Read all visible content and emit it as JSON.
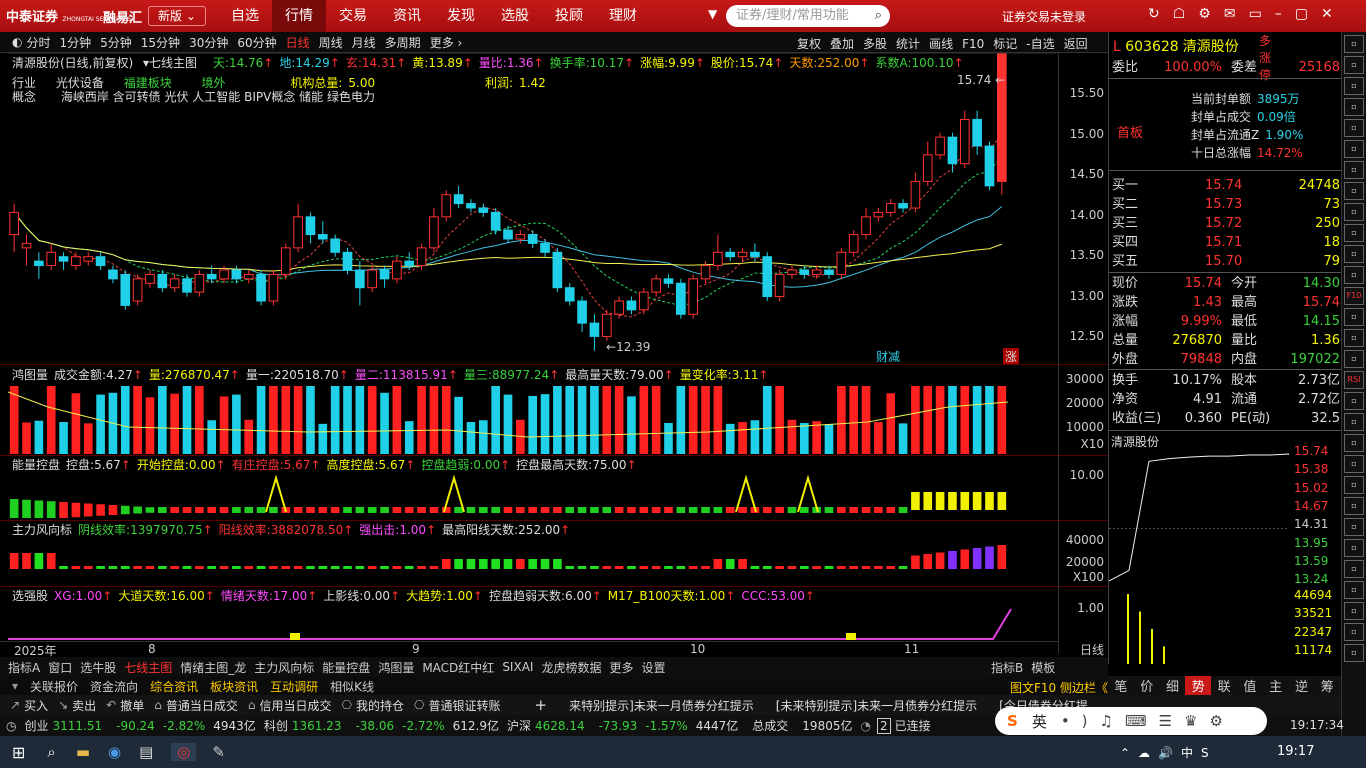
{
  "app": {
    "logo": "中泰证券",
    "logo_sub": "ZHONGTAI SECURITIES",
    "brand": "融易汇",
    "version": "新版",
    "menu": [
      "自选",
      "行情",
      "交易",
      "资讯",
      "发现",
      "选股",
      "投顾",
      "理财"
    ],
    "search_placeholder": "证券/理财/常用功能",
    "login": "证券交易未登录"
  },
  "toolbar": {
    "periods": [
      "分时",
      "1分钟",
      "5分钟",
      "15分钟",
      "30分钟",
      "60分钟",
      "日线",
      "周线",
      "月线",
      "多周期",
      "更多 ›"
    ],
    "tools": [
      "复权",
      "叠加",
      "多股",
      "统计",
      "画线",
      "F10",
      "标记",
      "-自选",
      "返回"
    ]
  },
  "ind1": {
    "name": "清源股份(日线,前复权)",
    "main": "七线主图",
    "items": [
      {
        "l": "天:",
        "v": "14.76",
        "c": "grn"
      },
      {
        "l": "地:",
        "v": "14.29",
        "c": "cyn"
      },
      {
        "l": "玄:",
        "v": "14.31",
        "c": "red"
      },
      {
        "l": "黄:",
        "v": "13.89",
        "c": "yel"
      },
      {
        "l": "量比:",
        "v": "1.36",
        "c": "mag"
      },
      {
        "l": "换手率:",
        "v": "10.17",
        "c": "grn"
      },
      {
        "l": "涨幅:",
        "v": "9.99",
        "c": "yel"
      },
      {
        "l": "股价:",
        "v": "15.74",
        "c": "yel"
      },
      {
        "l": "天数:",
        "v": "252.00",
        "c": "org"
      },
      {
        "l": "系数A:",
        "v": "100.10",
        "c": "grn"
      }
    ]
  },
  "info": {
    "industry_label": "行业",
    "industry": "光伏设备",
    "region": "福建板块",
    "abroad": "境外",
    "inst_label": "机构总量:",
    "inst": "5.00",
    "profit_label": "利润:",
    "profit": "1.42",
    "concept_label": "概念",
    "concepts": "海峡西岸 含可转债 光伏 人工智能 BIPV概念 储能 绿色电力"
  },
  "chart_labels": {
    "high": "15.74",
    "low": "12.39",
    "tag1": "财减",
    "tag2": "涨"
  },
  "ind2": {
    "name": "鸿图量",
    "items": [
      {
        "l": "成交金额:",
        "v": "4.27",
        "c": "wht"
      },
      {
        "l": "量:",
        "v": "276870.47",
        "c": "yel"
      },
      {
        "l": "量一:",
        "v": "220518.70",
        "c": "wht"
      },
      {
        "l": "量二:",
        "v": "113815.91",
        "c": "mag"
      },
      {
        "l": "量三:",
        "v": "88977.24",
        "c": "grn"
      },
      {
        "l": "最高量天数:",
        "v": "79.00",
        "c": "wht"
      },
      {
        "l": "量变化率:",
        "v": "3.11",
        "c": "yel"
      }
    ]
  },
  "ind3": {
    "name": "能量控盘",
    "items": [
      {
        "l": "控盘:",
        "v": "5.67",
        "c": "wht"
      },
      {
        "l": "开始控盘:",
        "v": "0.00",
        "c": "yel"
      },
      {
        "l": "有庄控盘:",
        "v": "5.67",
        "c": "red"
      },
      {
        "l": "高度控盘:",
        "v": "5.67",
        "c": "yel"
      },
      {
        "l": "控盘趋弱:",
        "v": "0.00",
        "c": "grn"
      },
      {
        "l": "控盘最高天数:",
        "v": "75.00",
        "c": "wht"
      }
    ]
  },
  "ind4": {
    "name": "主力风向标",
    "items": [
      {
        "l": "阴线效率:",
        "v": "1397970.75",
        "c": "grn"
      },
      {
        "l": "阳线效率:",
        "v": "3882078.50",
        "c": "red"
      },
      {
        "l": "强出击:",
        "v": "1.00",
        "c": "mag"
      },
      {
        "l": "最高阳线天数:",
        "v": "252.00",
        "c": "wht"
      }
    ]
  },
  "ind5": {
    "name": "选强股",
    "items": [
      {
        "l": "XG:",
        "v": "1.00",
        "c": "mag"
      },
      {
        "l": "大道天数:",
        "v": "16.00",
        "c": "yel"
      },
      {
        "l": "情绪天数:",
        "v": "17.00",
        "c": "mag"
      },
      {
        "l": "上影线:",
        "v": "0.00",
        "c": "wht"
      },
      {
        "l": "大趋势:",
        "v": "1.00",
        "c": "yel"
      },
      {
        "l": "控盘趋弱天数:",
        "v": "6.00",
        "c": "wht"
      },
      {
        "l": "M17_B100天数:",
        "v": "1.00",
        "c": "yel"
      },
      {
        "l": "CCC:",
        "v": "53.00",
        "c": "mag"
      }
    ]
  },
  "axes": {
    "price": [
      "15.50",
      "15.00",
      "14.50",
      "14.00",
      "13.50",
      "13.00",
      "12.50"
    ],
    "vol": [
      "30000",
      "20000",
      "10000"
    ],
    "vol_mult": "X10",
    "energy": [
      "10.00"
    ],
    "flow": [
      "40000",
      "20000"
    ],
    "flow_mult": "X100",
    "pick": [
      "1.00"
    ],
    "months": [
      "2025年",
      "8",
      "9",
      "10",
      "11"
    ],
    "period": "日线"
  },
  "tabs1": [
    "指标A",
    "窗口",
    "选牛股",
    "七线主图",
    "情绪主图_龙",
    "主力风向标",
    "能量控盘",
    "鸿图量",
    "MACD红中红",
    "SIXAI",
    "龙虎榜数据",
    "更多",
    "设置"
  ],
  "tabs1_right": [
    "指标B",
    "模板"
  ],
  "tabs2": [
    "关联报价",
    "资金流向",
    "综合资讯",
    "板块资讯",
    "互动调研",
    "相似K线"
  ],
  "right": {
    "code": "603628",
    "name": "清源股份",
    "tag": "多涨停",
    "wb_l": "委比",
    "wb": "100.00%",
    "wc_l": "委差",
    "wc": "25168",
    "board": "首板",
    "seal": [
      {
        "l": "当前封单额",
        "v": "3895万"
      },
      {
        "l": "封单占成交",
        "v": "0.09倍"
      },
      {
        "l": "封单占流通Z",
        "v": "1.90%"
      },
      {
        "l": "十日总涨幅",
        "v": "14.72%"
      }
    ],
    "bids": [
      {
        "l": "买一",
        "p": "15.74",
        "q": "24748"
      },
      {
        "l": "买二",
        "p": "15.73",
        "q": "73"
      },
      {
        "l": "买三",
        "p": "15.72",
        "q": "250"
      },
      {
        "l": "买四",
        "p": "15.71",
        "q": "18"
      },
      {
        "l": "买五",
        "p": "15.70",
        "q": "79"
      }
    ],
    "quote": [
      {
        "l": "现价",
        "v": "15.74",
        "l2": "今开",
        "v2": "14.30"
      },
      {
        "l": "涨跌",
        "v": "1.43",
        "l2": "最高",
        "v2": "15.74"
      },
      {
        "l": "涨幅",
        "v": "9.99%",
        "l2": "最低",
        "v2": "14.15"
      },
      {
        "l": "总量",
        "v": "276870",
        "l2": "量比",
        "v2": "1.36"
      },
      {
        "l": "外盘",
        "v": "79848",
        "l2": "内盘",
        "v2": "197022"
      }
    ],
    "fin": [
      {
        "l": "换手",
        "v": "10.17%",
        "l2": "股本",
        "v2": "2.73亿"
      },
      {
        "l": "净资",
        "v": "4.91",
        "l2": "流通",
        "v2": "2.72亿"
      },
      {
        "l": "收益(三)",
        "v": "0.360",
        "l2": "PE(动)",
        "v2": "32.5"
      }
    ],
    "mini_title": "清源股份",
    "mini_prices": [
      "15.74",
      "15.38",
      "15.02",
      "14.67",
      "14.31",
      "13.95",
      "13.59",
      "13.24"
    ],
    "mini_vols": [
      "44694",
      "33521",
      "22347",
      "11174"
    ],
    "tabs": [
      "笔",
      "价",
      "细",
      "势",
      "联",
      "值",
      "主",
      "逆",
      "筹"
    ]
  },
  "sidebar": [
    "F10",
    "RSI"
  ],
  "trade": [
    "买入",
    "卖出",
    "撤单",
    "普通当日成交",
    "信用当日成交",
    "我的持仓",
    "普通银证转账"
  ],
  "notices": [
    "来特别提示]未来一月债券分红提示",
    "[未来特别提示]未来一月债券分红提示",
    "[今日债券分红提"
  ],
  "status": {
    "idx1": "创业",
    "v1": "3111.51",
    "c1": "-90.24",
    "p1": "-2.82%",
    "a1": "4943亿",
    "idx2": "科创",
    "v2": "1361.23",
    "c2": "-38.06",
    "p2": "-2.72%",
    "a2": "612.9亿",
    "idx3": "沪深",
    "v3": "4628.14",
    "c3": "-73.93",
    "p3": "-1.57%",
    "a3": "4447亿",
    "tot_l": "总成交",
    "tot": "19805亿",
    "conn": "已连接",
    "conn_n": "2",
    "time": "19:17:34"
  },
  "ime": {
    "lang": "英"
  },
  "taskbar": {
    "time": "19:17"
  },
  "chart_data": {
    "type": "candlestick",
    "price_range": [
      12.25,
      15.75
    ],
    "candles": [
      [
        13.7,
        13.95,
        14.05,
        13.5
      ],
      [
        13.55,
        13.6,
        13.7,
        13.35
      ],
      [
        13.4,
        13.35,
        13.5,
        13.2
      ],
      [
        13.35,
        13.5,
        13.6,
        13.3
      ],
      [
        13.45,
        13.4,
        13.5,
        13.3
      ],
      [
        13.35,
        13.45,
        13.5,
        13.3
      ],
      [
        13.4,
        13.45,
        13.5,
        13.35
      ],
      [
        13.45,
        13.35,
        13.5,
        13.3
      ],
      [
        13.3,
        13.2,
        13.35,
        13.15
      ],
      [
        13.25,
        12.9,
        13.3,
        12.85
      ],
      [
        12.95,
        13.2,
        13.25,
        12.9
      ],
      [
        13.15,
        13.25,
        13.3,
        13.1
      ],
      [
        13.25,
        13.1,
        13.3,
        13.05
      ],
      [
        13.1,
        13.2,
        13.25,
        13.05
      ],
      [
        13.2,
        13.05,
        13.25,
        13.0
      ],
      [
        13.05,
        13.25,
        13.3,
        13.0
      ],
      [
        13.25,
        13.2,
        13.35,
        13.15
      ],
      [
        13.2,
        13.3,
        13.35,
        13.15
      ],
      [
        13.3,
        13.2,
        13.35,
        13.15
      ],
      [
        13.2,
        13.25,
        13.3,
        13.15
      ],
      [
        13.25,
        12.95,
        13.3,
        12.9
      ],
      [
        12.95,
        13.25,
        13.3,
        12.9
      ],
      [
        13.25,
        13.55,
        13.6,
        13.2
      ],
      [
        13.55,
        13.9,
        14.05,
        13.5
      ],
      [
        13.9,
        13.7,
        13.95,
        13.6
      ],
      [
        13.7,
        13.65,
        13.85,
        13.6
      ],
      [
        13.65,
        13.5,
        13.7,
        13.45
      ],
      [
        13.5,
        13.3,
        13.55,
        13.25
      ],
      [
        13.3,
        13.1,
        13.4,
        12.9
      ],
      [
        13.1,
        13.3,
        13.35,
        13.05
      ],
      [
        13.3,
        13.2,
        13.35,
        13.1
      ],
      [
        13.2,
        13.4,
        13.45,
        13.15
      ],
      [
        13.4,
        13.35,
        13.5,
        13.3
      ],
      [
        13.35,
        13.55,
        13.6,
        13.3
      ],
      [
        13.55,
        13.9,
        14.0,
        13.5
      ],
      [
        13.9,
        14.15,
        14.2,
        13.85
      ],
      [
        14.15,
        14.05,
        14.25,
        14.0
      ],
      [
        14.05,
        14.0,
        14.1,
        13.95
      ],
      [
        14.0,
        13.95,
        14.05,
        13.9
      ],
      [
        13.95,
        13.75,
        14.0,
        13.7
      ],
      [
        13.75,
        13.65,
        13.8,
        13.6
      ],
      [
        13.65,
        13.7,
        13.75,
        13.6
      ],
      [
        13.7,
        13.6,
        13.75,
        13.55
      ],
      [
        13.6,
        13.5,
        13.65,
        13.45
      ],
      [
        13.5,
        13.1,
        13.55,
        13.05
      ],
      [
        13.1,
        12.95,
        13.15,
        12.9
      ],
      [
        12.95,
        12.7,
        13.0,
        12.6
      ],
      [
        12.7,
        12.55,
        12.8,
        12.39
      ],
      [
        12.55,
        12.8,
        12.85,
        12.5
      ],
      [
        12.8,
        12.95,
        13.0,
        12.75
      ],
      [
        12.95,
        12.85,
        13.0,
        12.8
      ],
      [
        12.85,
        13.05,
        13.1,
        12.8
      ],
      [
        13.05,
        13.2,
        13.25,
        13.0
      ],
      [
        13.2,
        13.15,
        13.25,
        13.1
      ],
      [
        13.15,
        12.8,
        13.2,
        12.75
      ],
      [
        12.8,
        13.2,
        13.25,
        12.75
      ],
      [
        13.2,
        13.35,
        13.4,
        13.15
      ],
      [
        13.35,
        13.5,
        13.7,
        13.3
      ],
      [
        13.5,
        13.45,
        13.55,
        13.4
      ],
      [
        13.45,
        13.5,
        13.55,
        13.4
      ],
      [
        13.5,
        13.45,
        13.6,
        13.4
      ],
      [
        13.45,
        13.0,
        13.5,
        12.95
      ],
      [
        13.0,
        13.25,
        13.3,
        12.95
      ],
      [
        13.25,
        13.3,
        13.35,
        13.2
      ],
      [
        13.3,
        13.25,
        13.35,
        13.2
      ],
      [
        13.25,
        13.3,
        13.35,
        13.2
      ],
      [
        13.3,
        13.25,
        13.35,
        13.2
      ],
      [
        13.25,
        13.5,
        13.55,
        13.2
      ],
      [
        13.5,
        13.7,
        13.75,
        13.45
      ],
      [
        13.7,
        13.9,
        14.0,
        13.65
      ],
      [
        13.9,
        13.95,
        14.0,
        13.85
      ],
      [
        13.95,
        14.05,
        14.1,
        13.9
      ],
      [
        14.05,
        14.0,
        14.1,
        13.95
      ],
      [
        14.0,
        14.3,
        14.4,
        13.95
      ],
      [
        14.3,
        14.6,
        14.75,
        14.25
      ],
      [
        14.6,
        14.8,
        14.85,
        14.55
      ],
      [
        14.8,
        14.5,
        14.85,
        14.4
      ],
      [
        14.5,
        15.0,
        15.1,
        14.45
      ],
      [
        15.0,
        14.7,
        15.1,
        14.6
      ],
      [
        14.7,
        14.25,
        14.75,
        14.2
      ],
      [
        14.3,
        15.74,
        15.74,
        14.15
      ]
    ]
  },
  "mini_chart": {
    "price_range": [
      13.24,
      15.74
    ],
    "line": [
      13.3,
      13.5,
      15.6,
      15.65,
      15.68,
      15.7,
      15.7,
      15.72,
      15.72,
      15.74
    ],
    "vols": [
      44694,
      33521,
      22347,
      11174
    ]
  }
}
